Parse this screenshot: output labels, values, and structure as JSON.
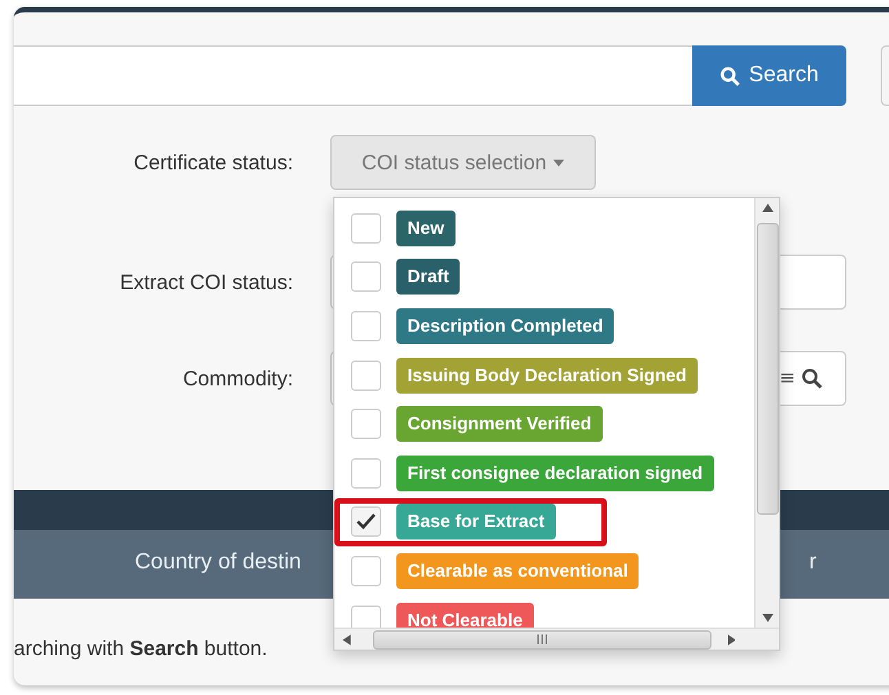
{
  "search": {
    "button": "Search"
  },
  "filters": [
    {
      "label": "Certificate status:",
      "kind": "dropdown",
      "value": "COI status selection"
    },
    {
      "label": "Extract COI status:",
      "kind": "field"
    },
    {
      "label": "Commodity:",
      "kind": "lookup",
      "icon_text": "≡"
    }
  ],
  "table": {
    "columns": [
      "Country of destin",
      "r"
    ]
  },
  "hint": "arching with **Search** button.",
  "status_menu": {
    "items": [
      {
        "label": "New",
        "color": "#2b6469",
        "checked": false,
        "highlighted": false
      },
      {
        "label": "Draft",
        "color": "#29606a",
        "checked": false,
        "highlighted": false
      },
      {
        "label": "Description Completed",
        "color": "#2f7885",
        "checked": false,
        "highlighted": false
      },
      {
        "label": "Issuing Body Declaration Signed",
        "color": "#a3a335",
        "checked": false,
        "highlighted": false
      },
      {
        "label": "Consignment Verified",
        "color": "#68a631",
        "checked": false,
        "highlighted": false
      },
      {
        "label": "First consignee declaration signed",
        "color": "#3ba63a",
        "checked": false,
        "highlighted": false
      },
      {
        "label": "Base for Extract",
        "color": "#37a896",
        "checked": true,
        "highlighted": true
      },
      {
        "label": "Clearable as conventional",
        "color": "#f2961d",
        "checked": false,
        "highlighted": false
      },
      {
        "label": "Not Clearable",
        "color": "#ef5858",
        "checked": false,
        "highlighted": false
      }
    ]
  }
}
